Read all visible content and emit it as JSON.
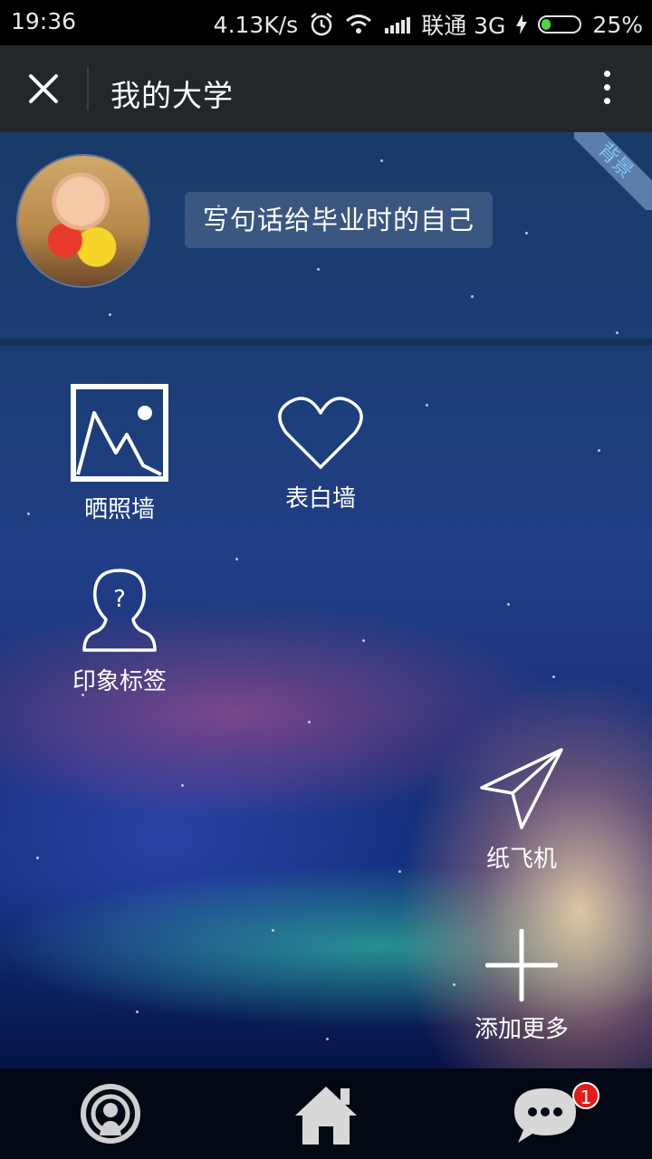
{
  "status_bar": {
    "time": "19:36",
    "net_speed": "4.13K/s",
    "carrier": "联通 3G",
    "battery": "25%",
    "battery_level": 0.25,
    "accent": "#57d337"
  },
  "titlebar": {
    "title": "我的大学",
    "close_icon": "close-icon",
    "more_icon": "more-vertical-icon"
  },
  "corner_ribbon": {
    "label": "背景"
  },
  "profile": {
    "avatar": "avatar-photo",
    "motto_button": "写句话给毕业时的自己"
  },
  "apps": [
    {
      "label": "晒照墙",
      "icon": "photo-icon"
    },
    {
      "label": "表白墙",
      "icon": "heart-icon"
    },
    {
      "label": "印象标签",
      "icon": "person-question-icon"
    },
    {
      "label": "纸飞机",
      "icon": "paper-plane-icon"
    },
    {
      "label": "添加更多",
      "icon": "plus-icon"
    }
  ],
  "bottom_bar": {
    "tabs": [
      {
        "icon": "broadcast-icon"
      },
      {
        "icon": "home-icon"
      },
      {
        "icon": "chat-icon",
        "badge": "1"
      }
    ]
  }
}
